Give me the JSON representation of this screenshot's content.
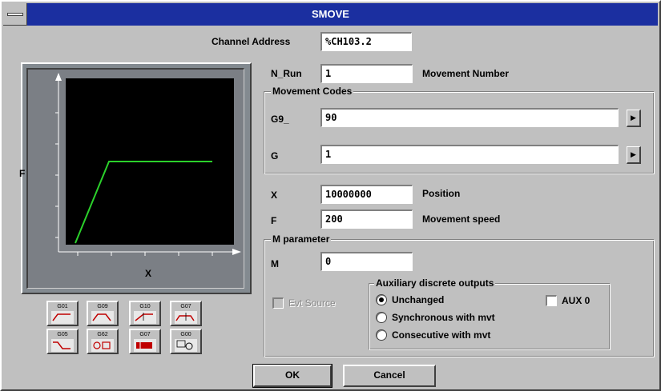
{
  "window": {
    "title": "SMOVE"
  },
  "channel": {
    "label": "Channel Address",
    "value": "%CH103.2"
  },
  "nrun": {
    "label": "N_Run",
    "value": "1",
    "desc": "Movement Number"
  },
  "movement_codes": {
    "title": "Movement Codes",
    "g9_label": "G9_",
    "g9_value": "90",
    "g_label": "G",
    "g_value": "1",
    "spin_glyph": "▶"
  },
  "x_field": {
    "label": "X",
    "value": "10000000",
    "desc": "Position"
  },
  "f_field": {
    "label": "F",
    "value": "200",
    "desc": "Movement speed"
  },
  "m_parameter": {
    "title": "M parameter",
    "m_label": "M",
    "m_value": "0"
  },
  "evt_source": {
    "label": "Evt Source",
    "checked": false,
    "enabled": false
  },
  "aux_outputs": {
    "title": "Auxiliary discrete outputs",
    "options": [
      "Unchanged",
      "Synchronous with mvt",
      "Consecutive with mvt"
    ],
    "selected": 0,
    "aux_label": "AUX 0",
    "aux_checked": false
  },
  "graph": {
    "y_axis_label": "F",
    "x_axis_label": "X",
    "line_color": "#2bd12b",
    "bg_color": "#000000"
  },
  "icon_buttons": [
    {
      "icon": "profile-g01-icon",
      "text": "G01"
    },
    {
      "icon": "profile-g09-icon",
      "text": "G09"
    },
    {
      "icon": "profile-g10-icon",
      "text": "G10"
    },
    {
      "icon": "profile-g07-icon",
      "text": "G07"
    },
    {
      "icon": "profile-g05-icon",
      "text": "G05"
    },
    {
      "icon": "profile-g62-icon",
      "text": "G62"
    },
    {
      "icon": "profile-g07b-icon",
      "text": "G07"
    },
    {
      "icon": "profile-g00-icon",
      "text": "G00"
    }
  ],
  "buttons": {
    "ok": "OK",
    "cancel": "Cancel"
  }
}
